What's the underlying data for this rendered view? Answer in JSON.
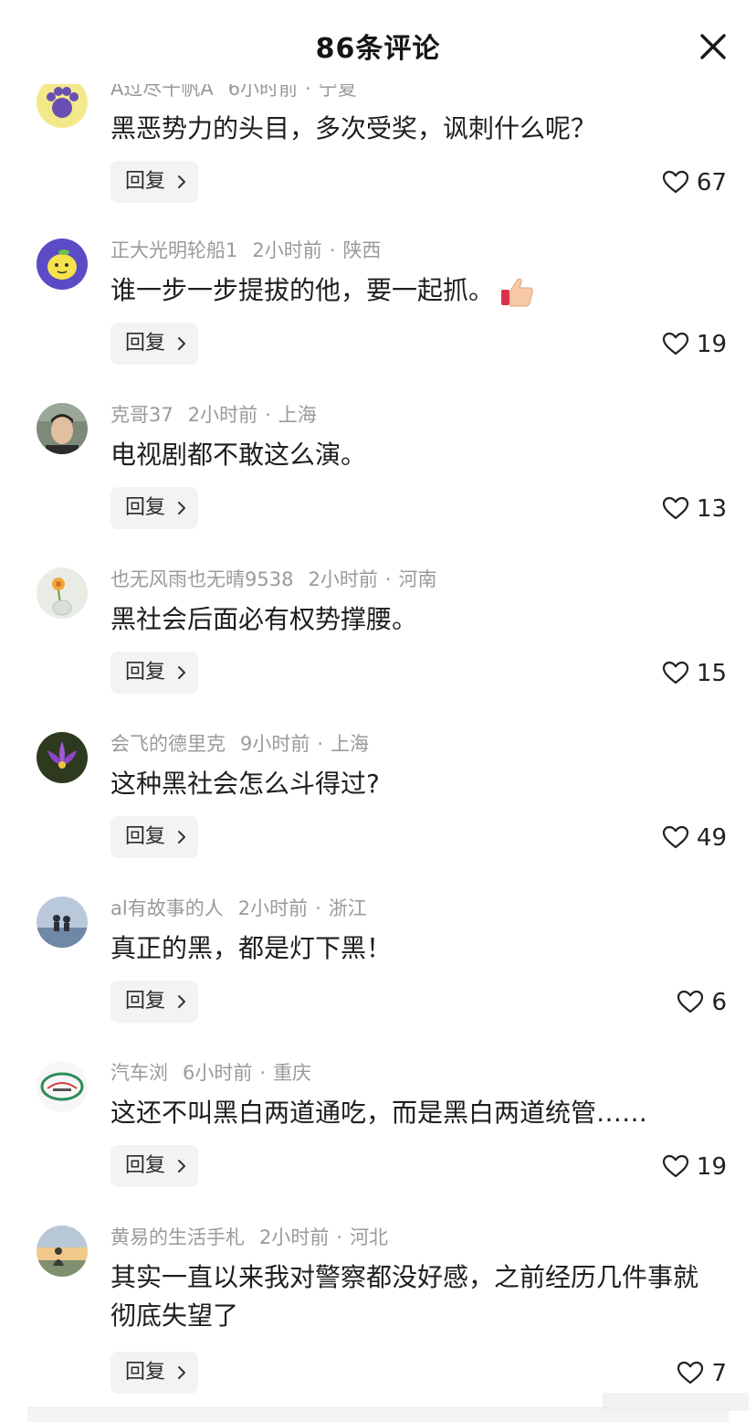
{
  "header": {
    "title": "86条评论",
    "close_icon": "close-icon"
  },
  "reply_label": "回复",
  "comments": [
    {
      "user": "A过尽千帆A",
      "time": "6小时前",
      "location": "宁夏",
      "text": "黑恶势力的头目，多次受奖，讽刺什么呢？",
      "likes": "67",
      "avatar": "cat-paw-avatar"
    },
    {
      "user": "正大光明轮船1",
      "time": "2小时前",
      "location": "陕西",
      "text": "谁一步一步提拔的他，要一起抓。",
      "likes": "19",
      "avatar": "lemon-avatar",
      "emoji": "thumbs-up-icon"
    },
    {
      "user": "克哥37",
      "time": "2小时前",
      "location": "上海",
      "text": "电视剧都不敢这么演。",
      "likes": "13",
      "avatar": "man-photo-avatar"
    },
    {
      "user": "也无风雨也无晴9538",
      "time": "2小时前",
      "location": "河南",
      "text": "黑社会后面必有权势撑腰。",
      "likes": "15",
      "avatar": "flower-vase-avatar"
    },
    {
      "user": "会飞的德里克",
      "time": "9小时前",
      "location": "上海",
      "text": "这种黑社会怎么斗得过?",
      "likes": "49",
      "avatar": "lotus-avatar"
    },
    {
      "user": "al有故事的人",
      "time": "2小时前",
      "location": "浙江",
      "text": "真正的黑，都是灯下黑！",
      "likes": "6",
      "avatar": "couple-silhouette-avatar"
    },
    {
      "user": "汽车浏",
      "time": "6小时前",
      "location": "重庆",
      "text": "这还不叫黑白两道通吃，而是黑白两道统管……",
      "likes": "19",
      "avatar": "car-logo-avatar"
    },
    {
      "user": "黄易的生活手札",
      "time": "2小时前",
      "location": "河北",
      "text": "其实一直以来我对警察都没好感，之前经历几件事就彻底失望了",
      "likes": "7",
      "avatar": "sunset-person-avatar"
    }
  ]
}
